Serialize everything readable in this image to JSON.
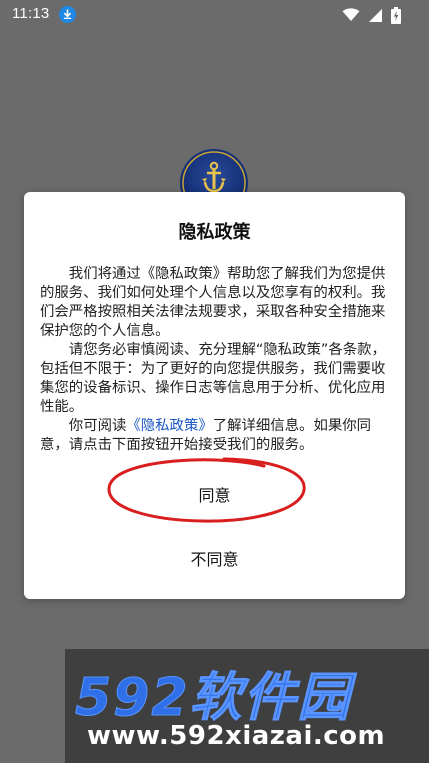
{
  "status_bar": {
    "time": "11:13",
    "download_icon": "download-icon",
    "wifi_icon": "wifi-icon",
    "signal_icon": "signal-icon",
    "battery_icon": "battery-charging-icon"
  },
  "app": {
    "logo_icon": "anchor-badge-icon"
  },
  "dialog": {
    "title": "隐私政策",
    "paragraph1": "我们将通过《隐私政策》帮助您了解我们为您提供的服务、我们如何处理个人信息以及您享有的权利。我们会严格按照相关法律法规要求，采取各种安全措施来保护您的个人信息。",
    "paragraph2": "请您务必审慎阅读、充分理解“隐私政策”各条款，包括但不限于：为了更好的向您提供服务，我们需要收集您的设备标识、操作日志等信息用于分析、优化应用性能。",
    "paragraph3_prefix": "你可阅读",
    "paragraph3_link": "《隐私政策》",
    "paragraph3_suffix": "了解详细信息。如果你同意，请点击下面按钮开始接受我们的服务。",
    "agree_label": "同意",
    "disagree_label": "不同意",
    "link_color": "#1a56c4",
    "annotation_color": "#d81e1e"
  },
  "watermark": {
    "brand": "592软件园",
    "url": "www.592xiazai.com",
    "brand_color": "#2f6fe8"
  }
}
